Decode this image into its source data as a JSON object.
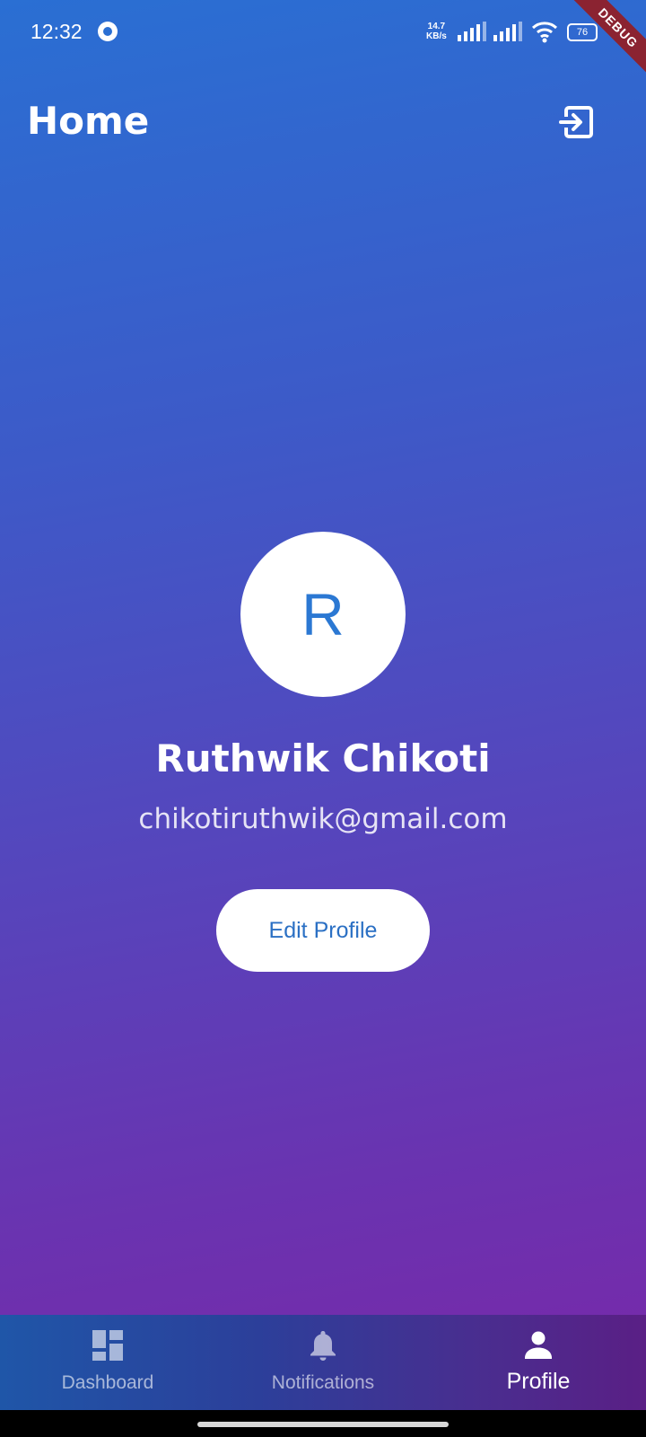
{
  "status_bar": {
    "time": "12:32",
    "net_speed_value": "14.7",
    "net_speed_unit": "KB/s",
    "battery": "76",
    "debug_label": "DEBUG"
  },
  "app_bar": {
    "title": "Home",
    "logout_icon": "logout-icon"
  },
  "profile": {
    "avatar_initial": "R",
    "name": "Ruthwik Chikoti",
    "email": "chikotiruthwik@gmail.com",
    "edit_button_label": "Edit Profile"
  },
  "bottom_nav": {
    "items": [
      {
        "label": "Dashboard",
        "icon": "dashboard-icon",
        "active": false
      },
      {
        "label": "Notifications",
        "icon": "bell-icon",
        "active": false
      },
      {
        "label": "Profile",
        "icon": "person-icon",
        "active": true
      }
    ]
  },
  "colors": {
    "gradient_start": "#2a6fd3",
    "gradient_end": "#7a27a8",
    "accent_text": "#2b78d3",
    "debug_banner": "#8b2331"
  }
}
